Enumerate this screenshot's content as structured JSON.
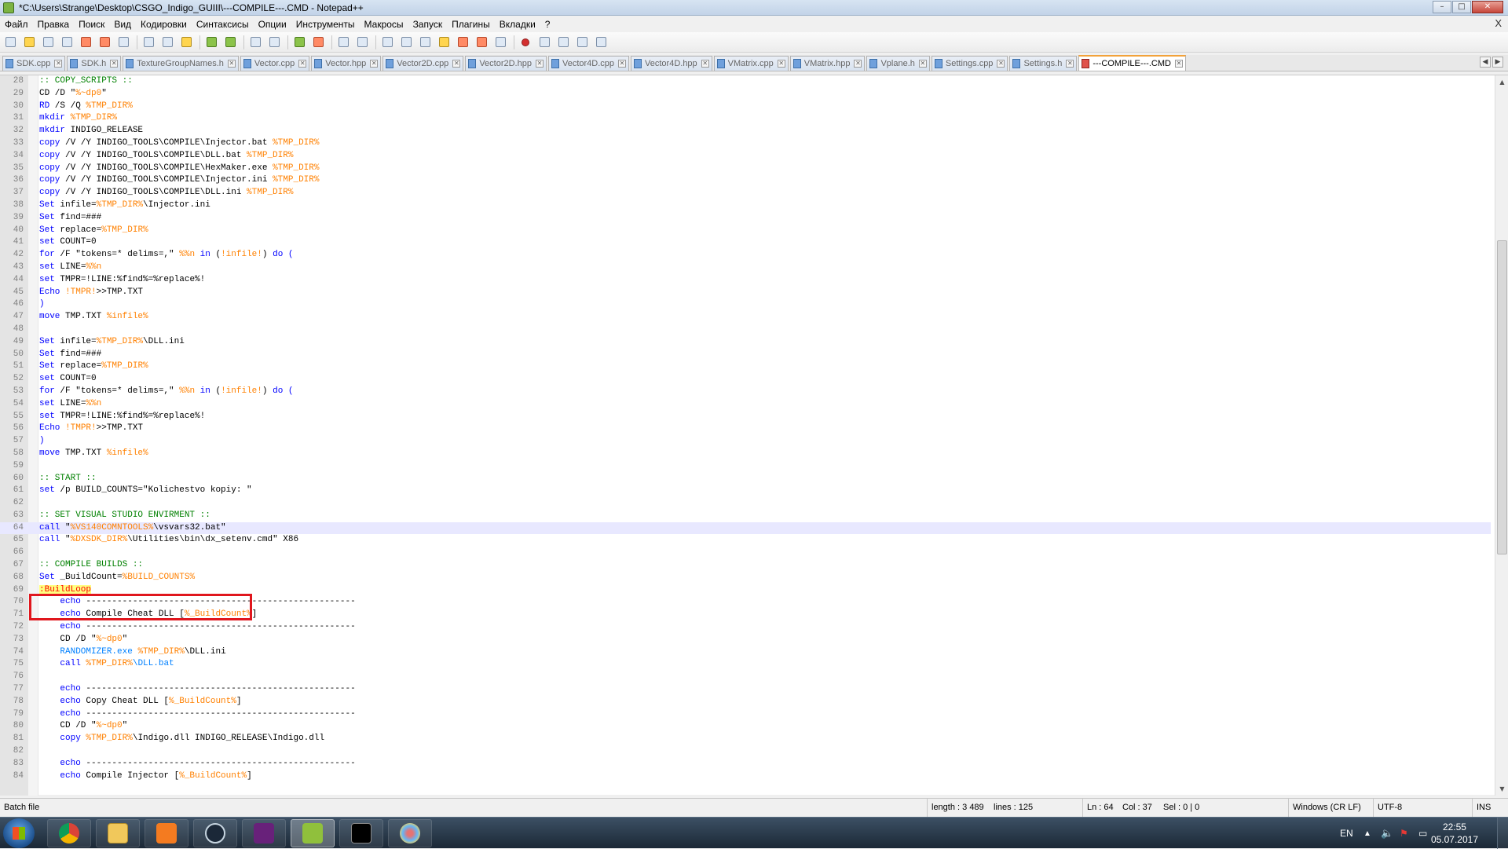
{
  "window": {
    "title": "*C:\\Users\\Strange\\Desktop\\CSGO_Indigo_GUIII\\---COMPILE---.CMD - Notepad++",
    "minimize": "–",
    "maximize": "□",
    "close": "✕"
  },
  "menu": {
    "items": [
      "Файл",
      "Правка",
      "Поиск",
      "Вид",
      "Кодировки",
      "Синтаксисы",
      "Опции",
      "Инструменты",
      "Макросы",
      "Запуск",
      "Плагины",
      "Вкладки",
      "?"
    ],
    "close": "X"
  },
  "tabs": [
    {
      "label": "SDK.cpp"
    },
    {
      "label": "SDK.h"
    },
    {
      "label": "TextureGroupNames.h"
    },
    {
      "label": "Vector.cpp"
    },
    {
      "label": "Vector.hpp"
    },
    {
      "label": "Vector2D.cpp"
    },
    {
      "label": "Vector2D.hpp"
    },
    {
      "label": "Vector4D.cpp"
    },
    {
      "label": "Vector4D.hpp"
    },
    {
      "label": "VMatrix.cpp"
    },
    {
      "label": "VMatrix.hpp"
    },
    {
      "label": "Vplane.h"
    },
    {
      "label": "Settings.cpp"
    },
    {
      "label": "Settings.h"
    },
    {
      "label": "---COMPILE---.CMD",
      "active": true
    }
  ],
  "tab_nav": {
    "left": "◀",
    "right": "▶"
  },
  "editor": {
    "current_line": 64,
    "lines": [
      {
        "n": "28",
        "html": "<span class=\"cm\">:: COPY_SCRIPTS ::</span>"
      },
      {
        "n": "29",
        "html": "CD /D \"<span class=\"vr\">%~dp0</span>\""
      },
      {
        "n": "30",
        "html": "<span class=\"kw\">RD</span> /S /Q <span class=\"vr\">%TMP_DIR%</span>"
      },
      {
        "n": "31",
        "html": "<span class=\"kw\">mkdir</span> <span class=\"vr\">%TMP_DIR%</span>"
      },
      {
        "n": "32",
        "html": "<span class=\"kw\">mkdir</span> INDIGO_RELEASE"
      },
      {
        "n": "33",
        "html": "<span class=\"kw\">copy</span> /V /Y INDIGO_TOOLS\\COMPILE\\Injector.bat <span class=\"vr\">%TMP_DIR%</span>"
      },
      {
        "n": "34",
        "html": "<span class=\"kw\">copy</span> /V /Y INDIGO_TOOLS\\COMPILE\\DLL.bat <span class=\"vr\">%TMP_DIR%</span>"
      },
      {
        "n": "35",
        "html": "<span class=\"kw\">copy</span> /V /Y INDIGO_TOOLS\\COMPILE\\HexMaker.exe <span class=\"vr\">%TMP_DIR%</span>"
      },
      {
        "n": "36",
        "html": "<span class=\"kw\">copy</span> /V /Y INDIGO_TOOLS\\COMPILE\\Injector.ini <span class=\"vr\">%TMP_DIR%</span>"
      },
      {
        "n": "37",
        "html": "<span class=\"kw\">copy</span> /V /Y INDIGO_TOOLS\\COMPILE\\DLL.ini <span class=\"vr\">%TMP_DIR%</span>"
      },
      {
        "n": "38",
        "html": "<span class=\"kw\">Set</span> infile=<span class=\"vr\">%TMP_DIR%</span>\\Injector.ini"
      },
      {
        "n": "39",
        "html": "<span class=\"kw\">Set</span> find=###"
      },
      {
        "n": "40",
        "html": "<span class=\"kw\">Set</span> replace=<span class=\"vr\">%TMP_DIR%</span>"
      },
      {
        "n": "41",
        "html": "<span class=\"kw\">set</span> COUNT=0"
      },
      {
        "n": "42",
        "html": "<span class=\"kw\">for</span> /F \"tokens=* delims=,\" <span class=\"vr\">%%n</span> <span class=\"kw\">in</span> (<span class=\"vr\">!infile!</span>) <span class=\"kw\">do</span> <span class=\"kw\">(</span>"
      },
      {
        "n": "43",
        "html": "<span class=\"kw\">set</span> LINE=<span class=\"vr\">%%n</span>"
      },
      {
        "n": "44",
        "html": "<span class=\"kw\">set</span> TMPR=!LINE:%find%=%replace%!"
      },
      {
        "n": "45",
        "html": "<span class=\"kw\">Echo</span> <span class=\"vr\">!TMPR!</span>&gt;&gt;TMP.TXT"
      },
      {
        "n": "46",
        "html": "<span class=\"kw\">)</span>"
      },
      {
        "n": "47",
        "html": "<span class=\"kw\">move</span> TMP.TXT <span class=\"vr\">%infile%</span>"
      },
      {
        "n": "48",
        "html": ""
      },
      {
        "n": "49",
        "html": "<span class=\"kw\">Set</span> infile=<span class=\"vr\">%TMP_DIR%</span>\\DLL.ini"
      },
      {
        "n": "50",
        "html": "<span class=\"kw\">Set</span> find=###"
      },
      {
        "n": "51",
        "html": "<span class=\"kw\">Set</span> replace=<span class=\"vr\">%TMP_DIR%</span>"
      },
      {
        "n": "52",
        "html": "<span class=\"kw\">set</span> COUNT=0"
      },
      {
        "n": "53",
        "html": "<span class=\"kw\">for</span> /F \"tokens=* delims=,\" <span class=\"vr\">%%n</span> <span class=\"kw\">in</span> (<span class=\"vr\">!infile!</span>) <span class=\"kw\">do</span> <span class=\"kw\">(</span>"
      },
      {
        "n": "54",
        "html": "<span class=\"kw\">set</span> LINE=<span class=\"vr\">%%n</span>"
      },
      {
        "n": "55",
        "html": "<span class=\"kw\">set</span> TMPR=!LINE:%find%=%replace%!"
      },
      {
        "n": "56",
        "html": "<span class=\"kw\">Echo</span> <span class=\"vr\">!TMPR!</span>&gt;&gt;TMP.TXT"
      },
      {
        "n": "57",
        "html": "<span class=\"kw\">)</span>"
      },
      {
        "n": "58",
        "html": "<span class=\"kw\">move</span> TMP.TXT <span class=\"vr\">%infile%</span>"
      },
      {
        "n": "59",
        "html": ""
      },
      {
        "n": "60",
        "html": "<span class=\"cm\">:: START ::</span>"
      },
      {
        "n": "61",
        "html": "<span class=\"kw\">set</span> /p BUILD_COUNTS=\"Kolichestvo kopiy: \""
      },
      {
        "n": "62",
        "html": ""
      },
      {
        "n": "63",
        "html": "<span class=\"cm\">:: SET VISUAL STUDIO ENVIRMENT ::</span>"
      },
      {
        "n": "64",
        "html": "<span class=\"kw\">call</span> \"<span class=\"vr\">%VS140COMNTOOLS%</span>\\vsvars32.bat\""
      },
      {
        "n": "65",
        "html": "<span class=\"kw\">call</span> \"<span class=\"vr\">%DXSDK_DIR%</span>\\Utilities\\bin\\dx_setenv.cmd\" X86"
      },
      {
        "n": "66",
        "html": ""
      },
      {
        "n": "67",
        "html": "<span class=\"cm\">:: COMPILE BUILDS ::</span>"
      },
      {
        "n": "68",
        "html": "<span class=\"kw\">Set</span> _BuildCount=<span class=\"vr\">%BUILD_COUNTS%</span>"
      },
      {
        "n": "69",
        "html": "<span class=\"lb\">:BuildLoop</span>"
      },
      {
        "n": "70",
        "html": "    <span class=\"kw\">echo</span> ----------------------------------------------------"
      },
      {
        "n": "71",
        "html": "    <span class=\"kw\">echo</span> Compile Cheat DLL [<span class=\"vr\">%_BuildCount%</span>]"
      },
      {
        "n": "72",
        "html": "    <span class=\"kw\">echo</span> ----------------------------------------------------"
      },
      {
        "n": "73",
        "html": "    CD /D \"<span class=\"vr\">%~dp0</span>\""
      },
      {
        "n": "74",
        "html": "    <span class=\"ex\">RANDOMIZER.exe</span> <span class=\"vr\">%TMP_DIR%</span>\\DLL.ini"
      },
      {
        "n": "75",
        "html": "    <span class=\"kw\">call</span> <span class=\"vr\">%TMP_DIR%</span><span class=\"ex\">\\DLL.bat</span>"
      },
      {
        "n": "76",
        "html": ""
      },
      {
        "n": "77",
        "html": "    <span class=\"kw\">echo</span> ----------------------------------------------------"
      },
      {
        "n": "78",
        "html": "    <span class=\"kw\">echo</span> Copy Cheat DLL [<span class=\"vr\">%_BuildCount%</span>]"
      },
      {
        "n": "79",
        "html": "    <span class=\"kw\">echo</span> ----------------------------------------------------"
      },
      {
        "n": "80",
        "html": "    CD /D \"<span class=\"vr\">%~dp0</span>\""
      },
      {
        "n": "81",
        "html": "    <span class=\"kw\">copy</span> <span class=\"vr\">%TMP_DIR%</span>\\Indigo.dll INDIGO_RELEASE\\Indigo.dll"
      },
      {
        "n": "82",
        "html": ""
      },
      {
        "n": "83",
        "html": "    <span class=\"kw\">echo</span> ----------------------------------------------------"
      },
      {
        "n": "84",
        "html": "    <span class=\"kw\">echo</span> Compile Injector [<span class=\"vr\">%_BuildCount%</span>]"
      }
    ]
  },
  "status": {
    "file_type": "Batch file",
    "length": "length : 3 489",
    "lines": "lines : 125",
    "ln": "Ln : 64",
    "col": "Col : 37",
    "sel": "Sel : 0 | 0",
    "eol": "Windows (CR LF)",
    "encoding": "UTF-8",
    "mode": "INS"
  },
  "taskbar": {
    "language": "EN",
    "time": "22:55",
    "date": "05.07.2017"
  }
}
